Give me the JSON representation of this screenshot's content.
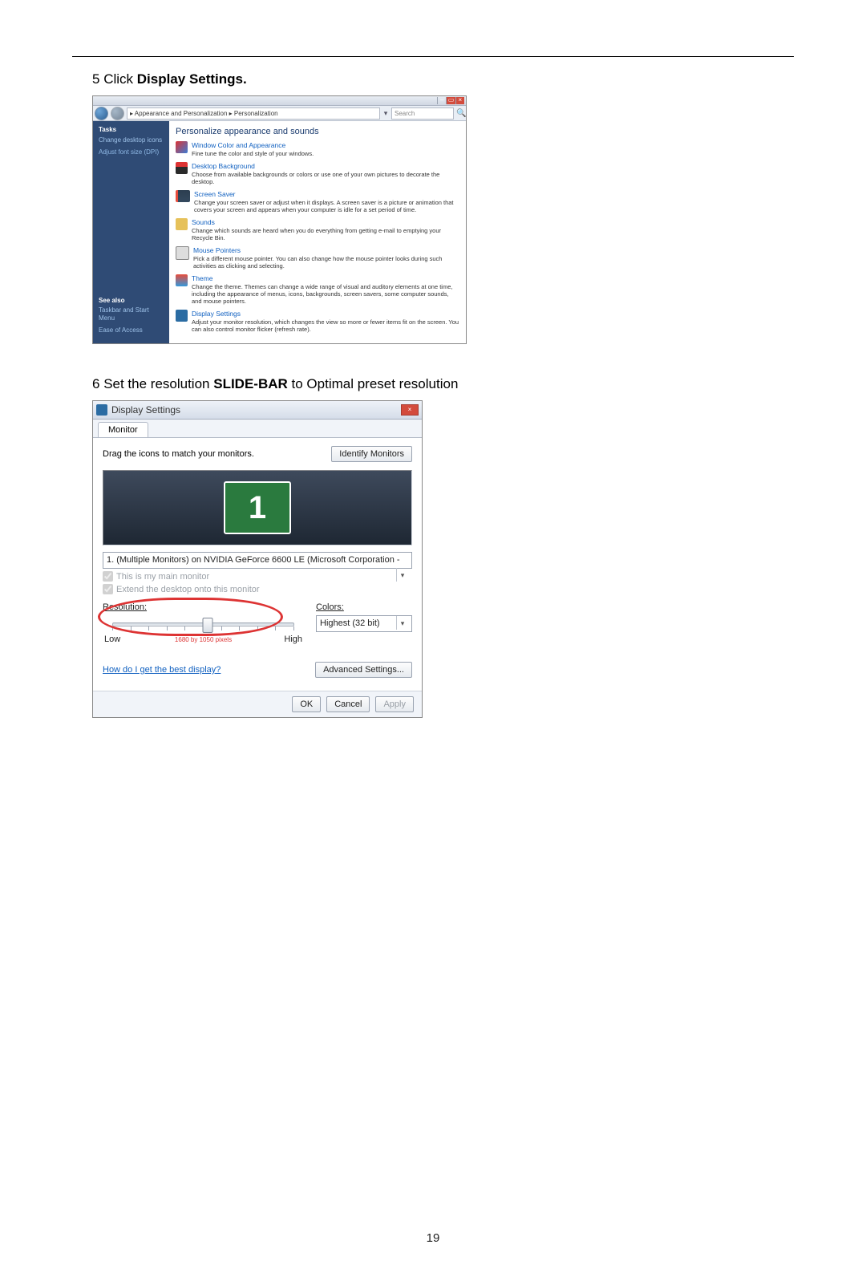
{
  "page_number": "19",
  "step5": {
    "num": "5",
    "prefix": " Click ",
    "bold": "Display Settings.",
    "suffix": ""
  },
  "step6": {
    "num": "6",
    "prefix": " Set the resolution ",
    "bold": "SLIDE-BAR",
    "suffix": " to Optimal preset resolution"
  },
  "win1": {
    "breadcrumb": "▸ Appearance and Personalization ▸ Personalization",
    "search_ph": "Search",
    "left": {
      "tasks": "Tasks",
      "l1": "Change desktop icons",
      "l2": "Adjust font size (DPI)",
      "see": "See also",
      "s1": "Taskbar and Start Menu",
      "s2": "Ease of Access"
    },
    "title": "Personalize appearance and sounds",
    "items": [
      {
        "t": "Window Color and Appearance",
        "d": "Fine tune the color and style of your windows."
      },
      {
        "t": "Desktop Background",
        "d": "Choose from available backgrounds or colors or use one of your own pictures to decorate the desktop."
      },
      {
        "t": "Screen Saver",
        "d": "Change your screen saver or adjust when it displays. A screen saver is a picture or animation that covers your screen and appears when your computer is idle for a set period of time."
      },
      {
        "t": "Sounds",
        "d": "Change which sounds are heard when you do everything from getting e-mail to emptying your Recycle Bin."
      },
      {
        "t": "Mouse Pointers",
        "d": "Pick a different mouse pointer. You can also change how the mouse pointer looks during such activities as clicking and selecting."
      },
      {
        "t": "Theme",
        "d": "Change the theme. Themes can change a wide range of visual and auditory elements at one time, including the appearance of menus, icons, backgrounds, screen savers, some computer sounds, and mouse pointers."
      },
      {
        "t": "Display Settings",
        "d": "Adjust your monitor resolution, which changes the view so more or fewer items fit on the screen. You can also control monitor flicker (refresh rate)."
      }
    ]
  },
  "win2": {
    "title": "Display Settings",
    "tab": "Monitor",
    "drag": "Drag the icons to match your monitors.",
    "identify": "Identify Monitors",
    "mon_num": "1",
    "monitor_dd": "1. (Multiple Monitors) on NVIDIA GeForce 6600 LE (Microsoft Corporation - ",
    "chk_main": "This is my main monitor",
    "chk_ext": "Extend the desktop onto this monitor",
    "res_lbl": "Resolution:",
    "low": "Low",
    "high": "High",
    "res_caption": "1680 by 1050 pixels",
    "colors_lbl": "Colors:",
    "colors_val": "Highest (32 bit)",
    "help": "How do I get the best display?",
    "adv": "Advanced Settings...",
    "ok": "OK",
    "cancel": "Cancel",
    "apply": "Apply"
  }
}
